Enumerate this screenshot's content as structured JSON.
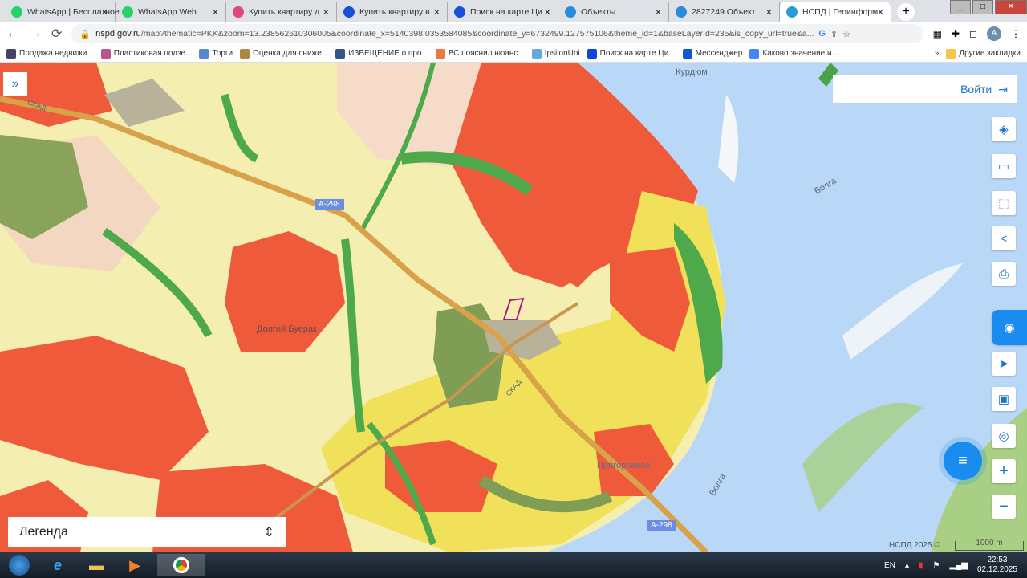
{
  "browser": {
    "tabs": [
      {
        "title": "WhatsApp | Бесплатное",
        "color": "#25d366"
      },
      {
        "title": "WhatsApp Web",
        "color": "#25d366"
      },
      {
        "title": "Купить квартиру д",
        "color": "#e0457b"
      },
      {
        "title": "Купить квартиру в",
        "color": "#1a4fd8"
      },
      {
        "title": "Поиск на карте Ци",
        "color": "#1a4fd8"
      },
      {
        "title": "Объекты",
        "color": "#2a8bd8"
      },
      {
        "title": "2827249 Объект",
        "color": "#2a8bd8"
      },
      {
        "title": "НСПД | Геоинформ",
        "color": "#2a9bd8",
        "active": true
      }
    ],
    "url_host": "nspd.gov.ru",
    "url_rest": "/map?thematic=PKK&zoom=13.238562610306005&coordinate_x=5140398.0353584085&coordinate_y=6732499.127575106&theme_id=1&baseLayerId=235&is_copy_url=true&a...",
    "profile_initial": "A",
    "bookmarks": [
      "Продажа недвижи...",
      "Пластиковая подзе...",
      "Торги",
      "Оценка для сниже...",
      "ИЗВЕЩЕНИЕ о про...",
      "ВС пояснил нюанс...",
      "IpsilonUni",
      "Поиск на карте Ци...",
      "Мессенджер",
      "Каково значение и..."
    ],
    "other_bookmarks": "Другие закладки",
    "more": "»"
  },
  "map": {
    "login": "Войти",
    "legend": "Легенда",
    "labels": {
      "kurdyum": "Курдюм",
      "volga1": "Волга",
      "volga2": "Волга",
      "dolgy": "Долгий Буерак",
      "skad1": "СКАД",
      "skad2": "СКАД",
      "prigorodnoe": "Пригородное",
      "a298a": "А-298",
      "a298b": "А-298"
    },
    "copyright": "НСПД 2025 ©",
    "scale": "1000 m",
    "colors": {
      "water": "#b9d7f6",
      "residential": "#ef5a3a",
      "agri": "#f4eeb0",
      "forest": "#5fb24a",
      "industrial": "#b8b29a",
      "yellow": "#f1e05a"
    }
  },
  "taskbar": {
    "lang": "EN",
    "time": "22:53",
    "date": "02.12.2025"
  }
}
